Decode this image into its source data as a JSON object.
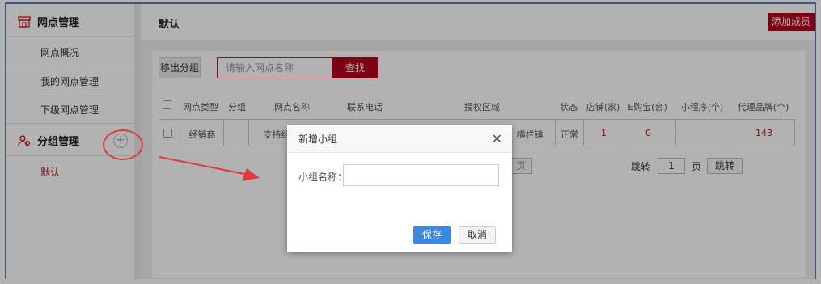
{
  "sidebar": {
    "group1": {
      "title": "网点管理",
      "icon": "store-icon"
    },
    "items": [
      {
        "label": "网点概况"
      },
      {
        "label": "我的网点管理"
      },
      {
        "label": "下级网点管理"
      }
    ],
    "group2": {
      "title": "分组管理",
      "icon": "group-icon",
      "add_icon": "plus-circle-icon"
    },
    "groups": [
      {
        "label": "默认"
      }
    ]
  },
  "header": {
    "title": "默认",
    "add_member_label": "添加成员"
  },
  "toolbar": {
    "move_out_label": "移出分组",
    "search_placeholder": "请输入网点名称",
    "search_label": "查找"
  },
  "table": {
    "headers": [
      "网点类型",
      "分组",
      "网点名称",
      "联系电话",
      "授权区域",
      "状态",
      "店铺(家)",
      "E购宝(台)",
      "小程序(个)",
      "代理品牌(个)"
    ],
    "rows": [
      {
        "type": "经销商",
        "group": "",
        "name": "支持组",
        "phone": "",
        "region": "横栏镇",
        "status": "正常",
        "shops": "1",
        "egoubao": "0",
        "miniapp": "",
        "brands": "143"
      }
    ]
  },
  "pager": {
    "page_partial": "页",
    "jump_label": "跳转",
    "page_value": "1",
    "page_unit": "页",
    "jump_button": "跳转"
  },
  "modal": {
    "title": "新增小组",
    "close_icon": "close-icon",
    "name_label": "小组名称：",
    "name_value": "",
    "save_label": "保存",
    "cancel_label": "取消"
  },
  "colors": {
    "brand_red": "#b3001b",
    "annotation_red": "#e03a3a",
    "primary_blue": "#3b8ad9",
    "frame_blue": "#5b7db8"
  }
}
